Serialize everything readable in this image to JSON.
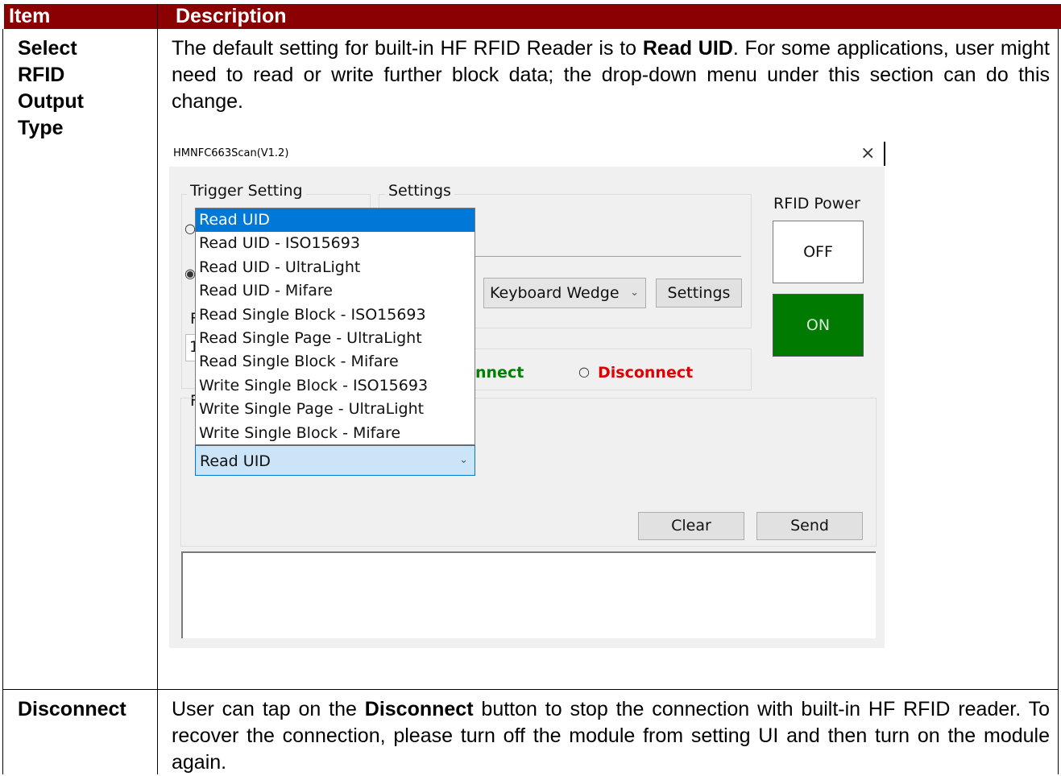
{
  "table": {
    "header_item": "Item",
    "header_description": "Description",
    "rows": [
      {
        "item_lines": [
          "Select",
          "RFID",
          "Output",
          "Type"
        ],
        "desc_part1": "The default setting for built-in HF RFID Reader is to ",
        "desc_bold": "Read UID",
        "desc_part2": ". For some applications, user might need to read or write further block data; the drop-down menu under this section can do this change."
      },
      {
        "item": "Disconnect",
        "desc_part1": "User can tap on the ",
        "desc_bold": "Disconnect",
        "desc_part2": " button to stop the connection with built-in HF RFID reader. To recover the connection, please turn off the module from setting UI and then turn on the module again."
      }
    ]
  },
  "app": {
    "title": "HMNFC663Scan(V1.2)",
    "close_glyph": "×",
    "trigger_setting_label": "Trigger Setting",
    "settings_group_label": "Settings",
    "output_mode_value": "Keyboard Wedge",
    "settings_button": "Settings",
    "connect_label_partial": "nnect",
    "disconnect_label": "Disconnect",
    "rfid_power_label": "RFID Power",
    "off_button": "OFF",
    "on_button": "ON",
    "hidden_fragments": [
      "F",
      "1",
      "F"
    ],
    "dropdown_options": [
      "Read UID",
      "Read UID - ISO15693",
      "Read UID - UltraLight",
      "Read UID - Mifare",
      "Read Single Block - ISO15693",
      "Read Single Page - UltraLight",
      "Read Single Block - Mifare",
      "Write Single Block - ISO15693",
      "Write Single Page - UltraLight",
      "Write Single Block - Mifare"
    ],
    "selected_option": "Read UID",
    "combo_value": "Read UID",
    "clear_button": "Clear",
    "send_button": "Send",
    "colors": {
      "header_bg": "#8B0000",
      "on_green": "#007a00",
      "connect_green": "#008000",
      "disconnect_red": "#e00000",
      "selection_blue": "#0078d7"
    }
  }
}
